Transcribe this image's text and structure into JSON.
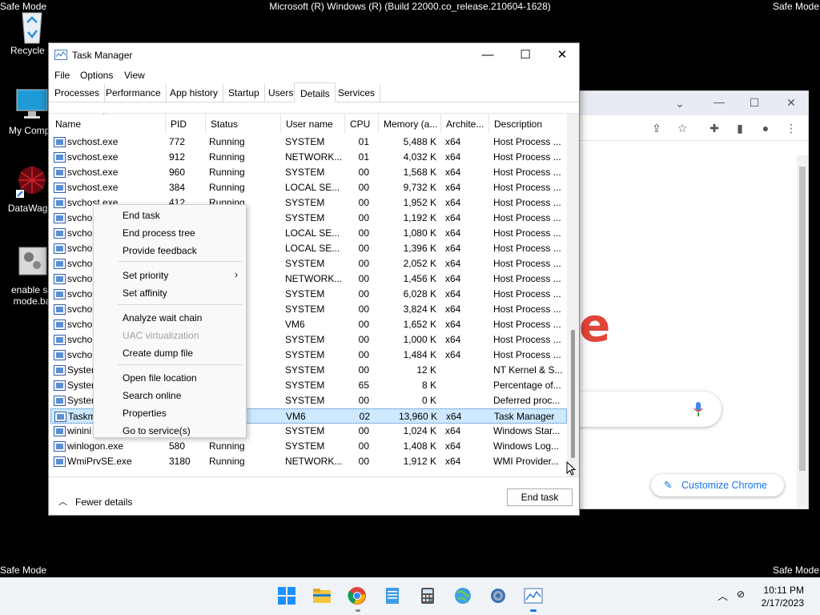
{
  "desktop": {
    "safe_mode_label": "Safe Mode",
    "build_title": "Microsoft (R) Windows (R) (Build 22000.co_release.210604-1628)",
    "icons": [
      {
        "label": "Recycle B",
        "icon": "recycle-bin-icon"
      },
      {
        "label": "My Compu",
        "icon": "computer-icon"
      },
      {
        "label": "DataWagor",
        "icon": "datawagon-icon"
      },
      {
        "label": "enable sa",
        "label2": "mode.ba",
        "icon": "batch-file-icon"
      }
    ]
  },
  "chrome": {
    "customize_label": "Customize Chrome",
    "accent": "#1a73e8"
  },
  "task_manager": {
    "title": "Task Manager",
    "menu": [
      "File",
      "Options",
      "View"
    ],
    "tabs": [
      "Processes",
      "Performance",
      "App history",
      "Startup",
      "Users",
      "Details",
      "Services"
    ],
    "active_tab": "Details",
    "columns": [
      "Name",
      "PID",
      "Status",
      "User name",
      "CPU",
      "Memory (a...",
      "Archite...",
      "Description"
    ],
    "rows": [
      {
        "name": "svchost.exe",
        "pid": "772",
        "status": "Running",
        "user": "SYSTEM",
        "cpu": "01",
        "mem": "5,488 K",
        "arch": "x64",
        "desc": "Host Process ..."
      },
      {
        "name": "svchost.exe",
        "pid": "912",
        "status": "Running",
        "user": "NETWORK...",
        "cpu": "01",
        "mem": "4,032 K",
        "arch": "x64",
        "desc": "Host Process ..."
      },
      {
        "name": "svchost.exe",
        "pid": "960",
        "status": "Running",
        "user": "SYSTEM",
        "cpu": "00",
        "mem": "1,568 K",
        "arch": "x64",
        "desc": "Host Process ..."
      },
      {
        "name": "svchost.exe",
        "pid": "384",
        "status": "Running",
        "user": "LOCAL SE...",
        "cpu": "00",
        "mem": "9,732 K",
        "arch": "x64",
        "desc": "Host Process ..."
      },
      {
        "name": "svchost.exe",
        "pid": "412",
        "status": "Running",
        "user": "SYSTEM",
        "cpu": "00",
        "mem": "1,952 K",
        "arch": "x64",
        "desc": "Host Process ..."
      },
      {
        "name": "svcho",
        "pid": "",
        "status": "",
        "user": "SYSTEM",
        "cpu": "00",
        "mem": "1,192 K",
        "arch": "x64",
        "desc": "Host Process ..."
      },
      {
        "name": "svcho",
        "pid": "",
        "status": "",
        "user": "LOCAL SE...",
        "cpu": "00",
        "mem": "1,080 K",
        "arch": "x64",
        "desc": "Host Process ..."
      },
      {
        "name": "svcho",
        "pid": "",
        "status": "",
        "user": "LOCAL SE...",
        "cpu": "00",
        "mem": "1,396 K",
        "arch": "x64",
        "desc": "Host Process ..."
      },
      {
        "name": "svcho",
        "pid": "",
        "status": "",
        "user": "SYSTEM",
        "cpu": "00",
        "mem": "2,052 K",
        "arch": "x64",
        "desc": "Host Process ..."
      },
      {
        "name": "svcho",
        "pid": "",
        "status": "",
        "user": "NETWORK...",
        "cpu": "00",
        "mem": "1,456 K",
        "arch": "x64",
        "desc": "Host Process ..."
      },
      {
        "name": "svcho",
        "pid": "",
        "status": "",
        "user": "SYSTEM",
        "cpu": "00",
        "mem": "6,028 K",
        "arch": "x64",
        "desc": "Host Process ..."
      },
      {
        "name": "svcho",
        "pid": "",
        "status": "",
        "user": "SYSTEM",
        "cpu": "00",
        "mem": "3,824 K",
        "arch": "x64",
        "desc": "Host Process ..."
      },
      {
        "name": "svcho",
        "pid": "",
        "status": "",
        "user": "VM6",
        "cpu": "00",
        "mem": "1,652 K",
        "arch": "x64",
        "desc": "Host Process ..."
      },
      {
        "name": "svcho",
        "pid": "",
        "status": "",
        "user": "SYSTEM",
        "cpu": "00",
        "mem": "1,000 K",
        "arch": "x64",
        "desc": "Host Process ..."
      },
      {
        "name": "svcho",
        "pid": "",
        "status": "",
        "user": "SYSTEM",
        "cpu": "00",
        "mem": "1,484 K",
        "arch": "x64",
        "desc": "Host Process ..."
      },
      {
        "name": "Syster",
        "pid": "",
        "status": "",
        "user": "SYSTEM",
        "cpu": "00",
        "mem": "12 K",
        "arch": "",
        "desc": "NT Kernel & S..."
      },
      {
        "name": "Syster",
        "pid": "",
        "status": "",
        "user": "SYSTEM",
        "cpu": "65",
        "mem": "8 K",
        "arch": "",
        "desc": "Percentage of..."
      },
      {
        "name": "Syster",
        "pid": "",
        "status": "",
        "user": "SYSTEM",
        "cpu": "00",
        "mem": "0 K",
        "arch": "",
        "desc": "Deferred proc..."
      },
      {
        "name": "Taskm",
        "pid": "",
        "status": "",
        "user": "VM6",
        "cpu": "02",
        "mem": "13,960 K",
        "arch": "x64",
        "desc": "Task Manager",
        "selected": true
      },
      {
        "name": "winini",
        "pid": "",
        "status": "",
        "user": "SYSTEM",
        "cpu": "00",
        "mem": "1,024 K",
        "arch": "x64",
        "desc": "Windows Star..."
      },
      {
        "name": "winlogon.exe",
        "pid": "580",
        "status": "Running",
        "user": "SYSTEM",
        "cpu": "00",
        "mem": "1,408 K",
        "arch": "x64",
        "desc": "Windows Log..."
      },
      {
        "name": "WmiPrvSE.exe",
        "pid": "3180",
        "status": "Running",
        "user": "NETWORK...",
        "cpu": "00",
        "mem": "1,912 K",
        "arch": "x64",
        "desc": "WMI Provider..."
      }
    ],
    "fewer_details": "Fewer details",
    "end_task": "End task"
  },
  "context_menu": {
    "items": [
      {
        "label": "End task"
      },
      {
        "label": "End process tree"
      },
      {
        "label": "Provide feedback"
      },
      {
        "label": "Set priority",
        "submenu": true
      },
      {
        "label": "Set affinity"
      },
      {
        "label": "Analyze wait chain"
      },
      {
        "label": "UAC virtualization",
        "disabled": true
      },
      {
        "label": "Create dump file"
      },
      {
        "label": "Open file location"
      },
      {
        "label": "Search online"
      },
      {
        "label": "Properties"
      },
      {
        "label": "Go to service(s)"
      }
    ]
  },
  "taskbar": {
    "time": "10:11 PM",
    "date": "2/17/2023",
    "apps": [
      "start-icon",
      "file-explorer-icon",
      "chrome-icon",
      "notepad-icon",
      "calculator-icon",
      "network-globe-icon",
      "settings-gear-icon",
      "task-manager-icon"
    ]
  }
}
